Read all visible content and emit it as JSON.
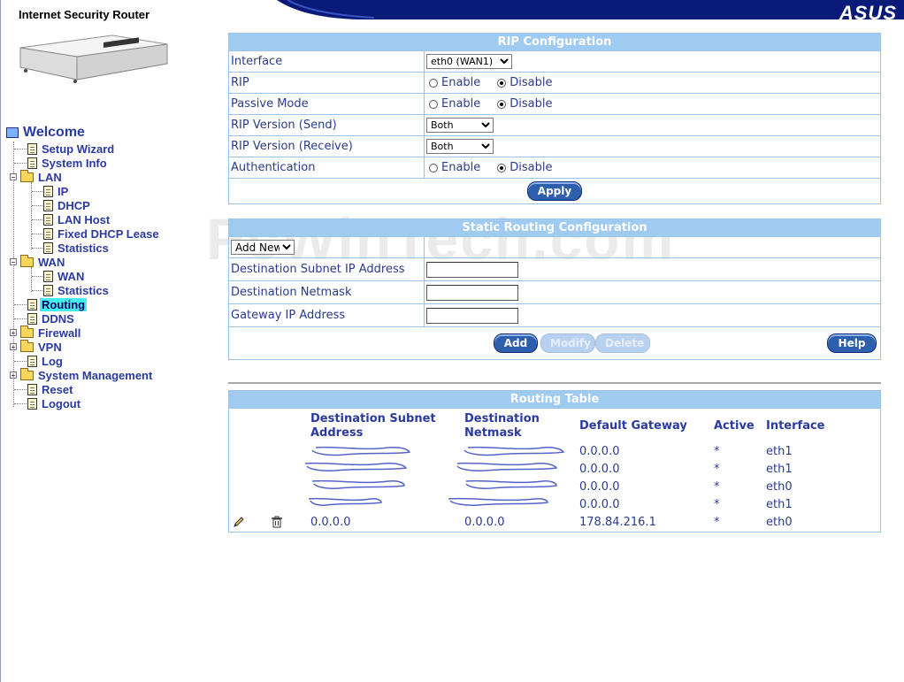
{
  "header": {
    "product_title": "Internet Security Router",
    "brand": "ASUS",
    "colors": {
      "swoosh": "#0a1a78",
      "accent": "#9fcbf0"
    }
  },
  "watermark": "PcWinTech.com",
  "nav": {
    "welcome": "Welcome",
    "items": [
      {
        "label": "Setup Wizard",
        "icon": "doc-icon"
      },
      {
        "label": "System Info",
        "icon": "doc-icon"
      },
      {
        "label": "LAN",
        "icon": "folder-open-icon"
      },
      {
        "label": "IP",
        "icon": "doc-icon"
      },
      {
        "label": "DHCP",
        "icon": "doc-icon"
      },
      {
        "label": "LAN Host",
        "icon": "doc-icon"
      },
      {
        "label": "Fixed DHCP Lease",
        "icon": "doc-icon"
      },
      {
        "label": "Statistics",
        "icon": "doc-icon"
      },
      {
        "label": "WAN",
        "icon": "folder-open-icon"
      },
      {
        "label": "WAN",
        "icon": "doc-icon"
      },
      {
        "label": "Statistics",
        "icon": "doc-icon"
      },
      {
        "label": "Routing",
        "icon": "doc-icon",
        "active": true
      },
      {
        "label": "DDNS",
        "icon": "doc-icon"
      },
      {
        "label": "Firewall",
        "icon": "folder-icon"
      },
      {
        "label": "VPN",
        "icon": "folder-icon"
      },
      {
        "label": "Log",
        "icon": "doc-icon"
      },
      {
        "label": "System Management",
        "icon": "folder-icon"
      },
      {
        "label": "Reset",
        "icon": "doc-icon"
      },
      {
        "label": "Logout",
        "icon": "doc-icon"
      }
    ]
  },
  "rip": {
    "title": "RIP Configuration",
    "interface_label": "Interface",
    "interface_value": "eth0 (WAN1)",
    "rip_label": "RIP",
    "passive_label": "Passive Mode",
    "version_send_label": "RIP Version (Send)",
    "version_send_value": "Both",
    "version_recv_label": "RIP Version (Receive)",
    "version_recv_value": "Both",
    "auth_label": "Authentication",
    "enable": "Enable",
    "disable": "Disable",
    "apply": "Apply"
  },
  "static": {
    "title": "Static Routing Configuration",
    "select_value": "Add New",
    "dest_ip_label": "Destination Subnet IP Address",
    "netmask_label": "Destination Netmask",
    "gateway_label": "Gateway IP Address",
    "add": "Add",
    "modify": "Modify",
    "delete": "Delete",
    "help": "Help"
  },
  "routing_table": {
    "title": "Routing Table",
    "headers": {
      "dest_line1": "Destination Subnet",
      "dest_line2": "Address",
      "mask_line1": "Destination",
      "mask_line2": "Netmask",
      "gateway": "Default Gateway",
      "active": "Active",
      "interface": "Interface"
    },
    "rows": [
      {
        "dest": "",
        "mask": "",
        "gateway": "0.0.0.0",
        "active": "*",
        "iface": "eth1"
      },
      {
        "dest": "",
        "mask": "",
        "gateway": "0.0.0.0",
        "active": "*",
        "iface": "eth1"
      },
      {
        "dest": "",
        "mask": "",
        "gateway": "0.0.0.0",
        "active": "*",
        "iface": "eth0"
      },
      {
        "dest": "",
        "mask": "",
        "gateway": "0.0.0.0",
        "active": "*",
        "iface": "eth1"
      },
      {
        "dest": "0.0.0.0",
        "mask": "0.0.0.0",
        "gateway": "178.84.216.1",
        "active": "*",
        "iface": "eth0"
      }
    ]
  }
}
